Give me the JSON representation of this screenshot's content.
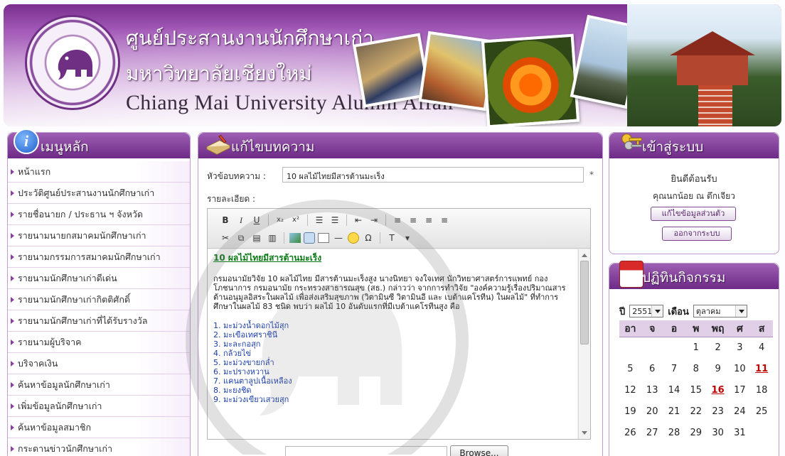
{
  "header": {
    "title_th_line1": "ศูนย์ประสานงานนักศึกษาเก่า",
    "title_th_line2": "มหาวิทยาลัยเชียงใหม่",
    "title_en": "Chiang Mai University Alumni Affair"
  },
  "left_menu": {
    "title": "เมนูหลัก",
    "items": [
      "หน้าแรก",
      "ประวัติศูนย์ประสานงานนักศึกษาเก่า",
      "รายชื่อนายก / ประธาน ฯ จังหวัด",
      "รายนามนายกสมาคมนักศึกษาเก่า",
      "รายนามกรรมการสมาคมนักศึกษาเก่า",
      "รายนามนักศึกษาเก่าดีเด่น",
      "รายนามนักศึกษาเก่ากิตติศักดิ์",
      "รายนามนักศึกษาเก่าที่ได้รับรางวัล",
      "รายนามผู้บริจาค",
      "บริจาคเงิน",
      "ค้นหาข้อมูลนักศึกษาเก่า",
      "เพิ่มข้อมูลนักศึกษาเก่า",
      "ค้นหาข้อมูลสมาชิก",
      "กระดานข่าวนักศึกษาเก่า"
    ]
  },
  "editor_panel": {
    "title": "แก้ไขบทความ",
    "subject_label": "หัวข้อบทความ :",
    "subject_value": "10 ผลไม้ไทยมีสารต้านมะเร็ง",
    "required_mark": "*",
    "detail_label": "รายละเอียด :",
    "toolbar": {
      "bold": "B",
      "italic": "I",
      "underline": "U",
      "subscript": "x₂",
      "superscript": "x²"
    },
    "content_title": "10 ผลไม้ไทยมีสารต้านมะเร็ง",
    "content_paragraph": "กรมอนามัยวิจัย 10 ผลไม้ไทย มีสารต้านมะเร็งสูง นางนิทยา จงใจเทศ นักวิทยาศาสตร์การแพทย์ กองโภชนาการ กรมอนามัย กระทรวงสาธารณสุข (สธ.) กล่าวว่า จากการทำวิจัย \"องค์ความรู้เรื่องปริมาณสารต้านอนุมูลอิสระในผลไม้ เพื่อส่งเสริมสุขภาพ (วิตามินซี วิตามินอี และ เบต้าแคโรทีน) ในผลไม้\" ที่ทำการศึกษาในผลไม้ 83 ชนิด พบว่า ผลไม้ 10 อันดับแรกที่มีเบต้าแคโรทีนสูง คือ",
    "fruit_list": [
      "1. มะม่วงน้ำดอกไม้สุก",
      "2. มะเขือเทศราชินี",
      "3. มะละกอสุก",
      "4. กล้วยไข่",
      "5. มะม่วงขายกล่ำ",
      "6. มะปรางหวาน",
      "7. แคนตาลูปเนื้อเหลือง",
      "8. มะยงชิด",
      "9. มะม่วงเขียวเสวยสุก"
    ],
    "browse_label": "Browse..."
  },
  "login_panel": {
    "title": "เข้าสู่ระบบ",
    "welcome": "ยินดีต้อนรับ",
    "user_name": "คุณนกน้อย ณ ตึกเจียว",
    "edit_profile_button": "แก้ไขข้อมูลส่วนตัว",
    "logout_button": "ออกจากระบบ"
  },
  "calendar_panel": {
    "title": "ปฏิทินกิจกรรม",
    "year_label": "ปี",
    "year_value": "2551",
    "month_label": "เดือน",
    "month_value": "ตุลาคม",
    "weekday_headers": [
      "อา",
      "จ",
      "อ",
      "พ",
      "พฤ",
      "ศ",
      "ส"
    ],
    "weeks": [
      [
        "",
        "",
        "",
        "1",
        "2",
        "3",
        "4"
      ],
      [
        "5",
        "6",
        "7",
        "8",
        "9",
        "10",
        "11"
      ],
      [
        "12",
        "13",
        "14",
        "15",
        "16",
        "17",
        "18"
      ],
      [
        "19",
        "20",
        "21",
        "22",
        "23",
        "24",
        "25"
      ],
      [
        "26",
        "27",
        "28",
        "29",
        "30",
        "31",
        ""
      ]
    ],
    "highlighted_days": [
      "11",
      "16"
    ]
  },
  "colors": {
    "brand_purple": "#6d2a86",
    "highlight_red": "#c00000",
    "article_green": "#0b7a16"
  }
}
